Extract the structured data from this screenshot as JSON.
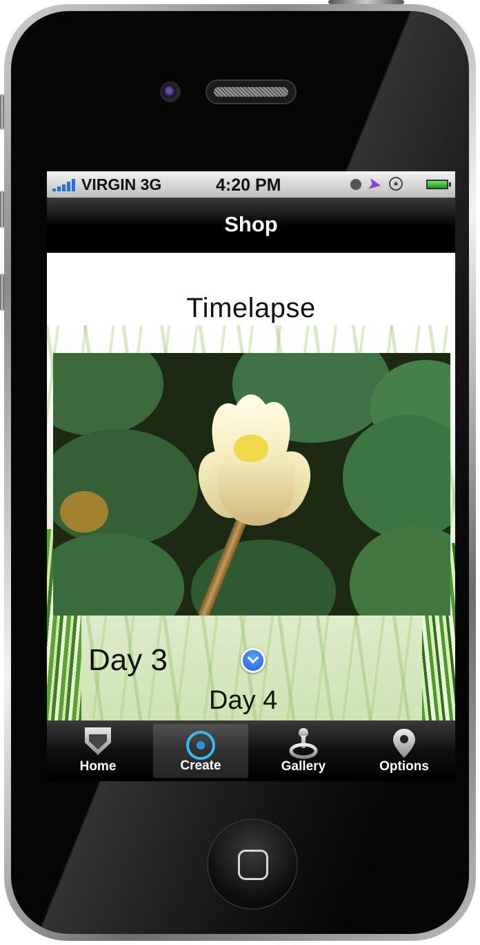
{
  "status_bar": {
    "carrier": "VIRGIN",
    "network": "3G",
    "time": "4:20 PM",
    "icons": [
      "signal-icon",
      "clock-icon",
      "location-arrow-icon",
      "rotation-lock-icon",
      "battery-icon"
    ]
  },
  "nav_bar": {
    "title": "Shop"
  },
  "content": {
    "title": "Timelapse",
    "photo_icon": "water-lily-photo",
    "day_current": "Day 3",
    "day_next": "Day 4",
    "chevron_icon": "chevron-down-icon"
  },
  "tab_bar": {
    "active_index": 1,
    "items": [
      {
        "label": "Home",
        "icon": "shield-icon"
      },
      {
        "label": "Create",
        "icon": "crosshair-icon"
      },
      {
        "label": "Gallery",
        "icon": "joystick-icon"
      },
      {
        "label": "Options",
        "icon": "map-pin-icon"
      }
    ]
  },
  "colors": {
    "status_bar": "#d6d6d6",
    "nav_bar": "#000000",
    "tab_bar": "#111111",
    "active_icon": "#3fb6f5",
    "chevron_button": "#2a74e0"
  }
}
